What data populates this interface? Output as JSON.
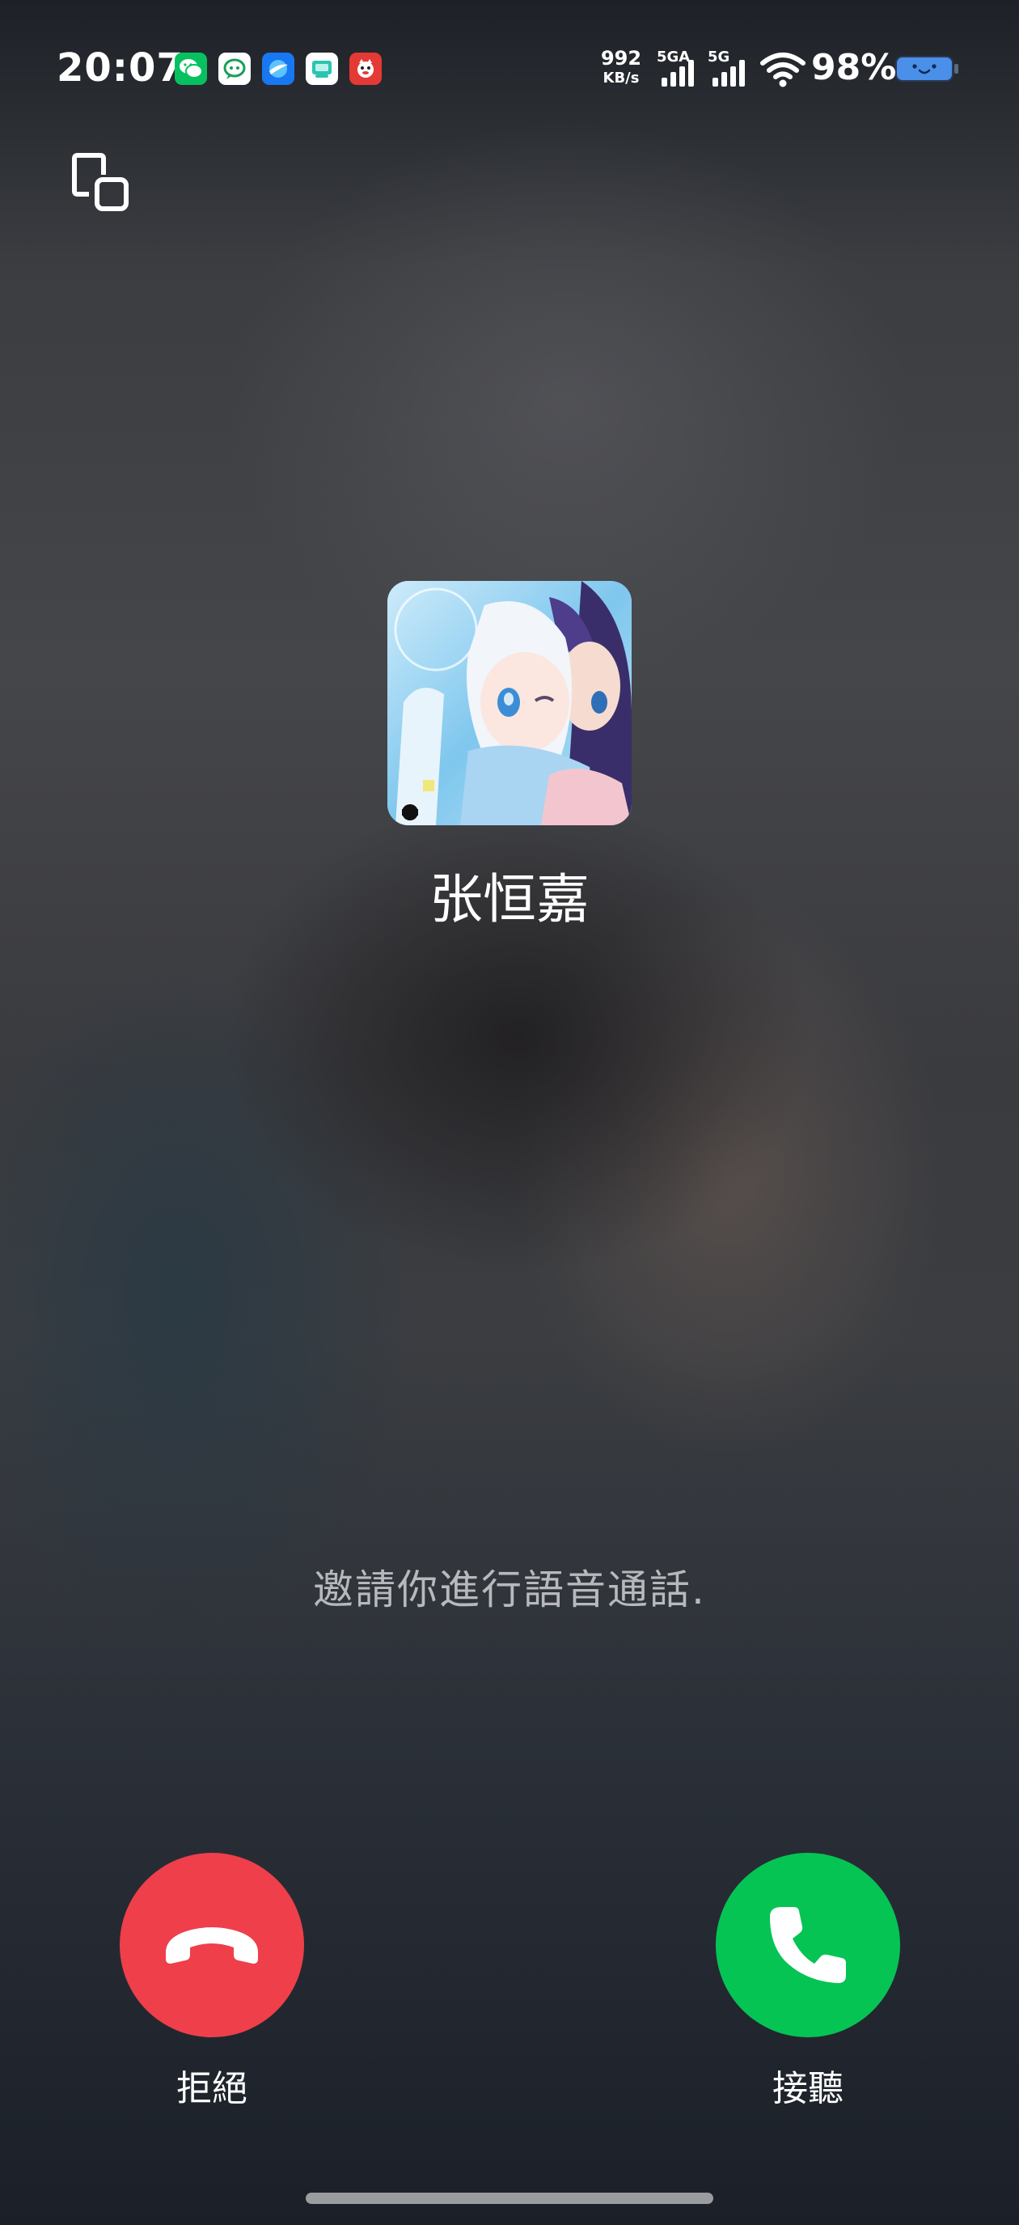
{
  "status_bar": {
    "time": "20:07",
    "notification_icons": [
      "wechat-icon",
      "chat-bubble-icon",
      "browser-icon",
      "message-app-icon",
      "mascot-app-icon"
    ],
    "network_speed_value": "992",
    "network_speed_unit": "KB/s",
    "signal_1_label": "5GA",
    "signal_2_label": "5G",
    "battery_percent": "98%",
    "colors": {
      "wechat": "#07c160",
      "browser": "#1877f2",
      "mascot_app": "#e53935",
      "battery_fill": "#4a8fe8"
    }
  },
  "call": {
    "caller_name": "张恒嘉",
    "status_text": "邀請你進行語音通話.",
    "decline_label": "拒絕",
    "accept_label": "接聽",
    "colors": {
      "decline": "#ee3f4b",
      "accept": "#05c454"
    }
  }
}
